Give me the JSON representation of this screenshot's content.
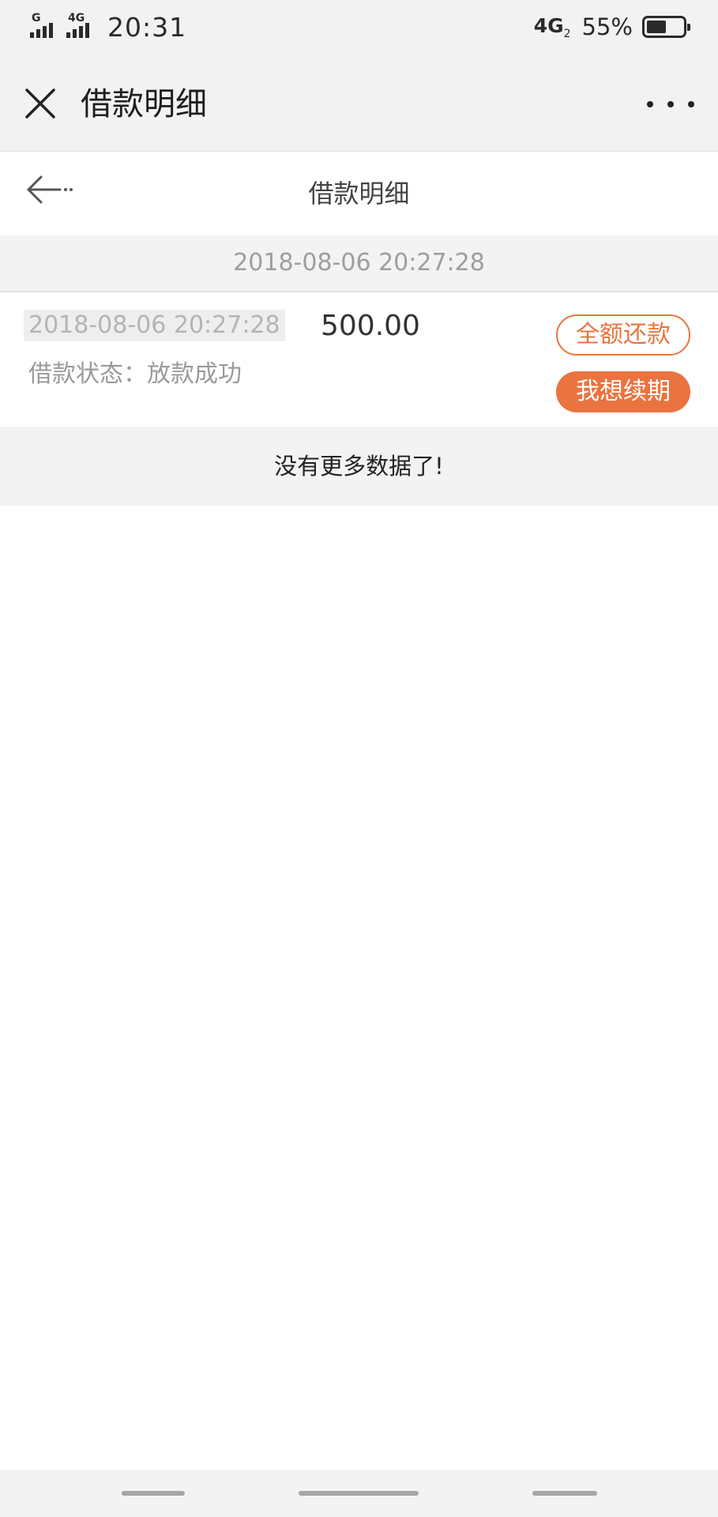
{
  "status_bar": {
    "sim1_tag": "G",
    "sim2_tag": "4G",
    "time": "20:31",
    "network": "4G",
    "network_sub": "2",
    "battery_percent_text": "55%",
    "battery_level": 0.55
  },
  "title_bar": {
    "title": "借款明细",
    "close_icon": "close-icon",
    "more_icon": "more-dots-icon"
  },
  "page_header": {
    "title": "借款明细",
    "back_icon": "back-arrow-icon"
  },
  "date_group": {
    "label": "2018-08-06 20:27:28"
  },
  "record": {
    "time": "2018-08-06 20:27:28",
    "amount": "500.00",
    "status_label": "借款状态：",
    "status_value": "放款成功",
    "repay_button": "全额还款",
    "renew_button": "我想续期"
  },
  "footer": {
    "no_more_text": "没有更多数据了!"
  },
  "colors": {
    "accent": "#ea7340",
    "background": "#f3f3f3"
  }
}
